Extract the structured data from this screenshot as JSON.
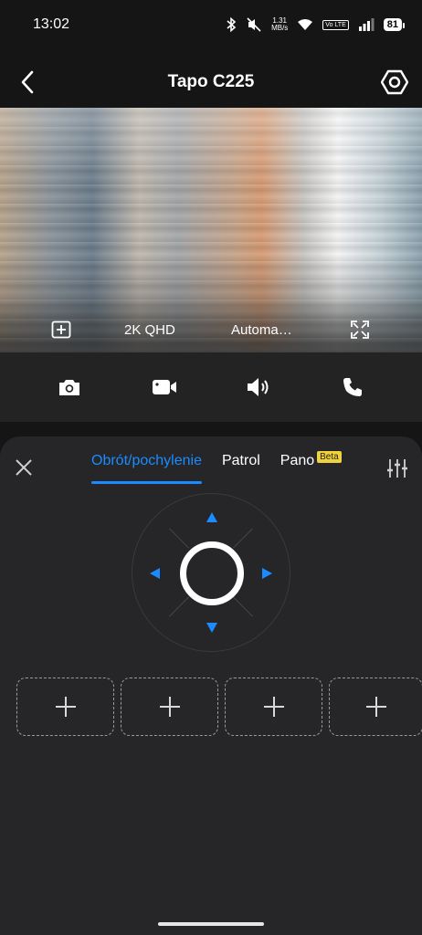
{
  "status_bar": {
    "time": "13:02",
    "speed_value": "1.31",
    "speed_unit": "MB/s",
    "volte": "Vo LTE",
    "battery": "81"
  },
  "header": {
    "title": "Tapo C225",
    "back_icon": "chevron-left-icon",
    "settings_icon": "hexagon-gear-icon"
  },
  "video_overlay": {
    "quality": "2K QHD",
    "mode": "Automa…",
    "add_icon": "plus-square-icon",
    "fullscreen_icon": "fullscreen-icon"
  },
  "controls": [
    {
      "name": "snapshot",
      "icon": "camera-icon"
    },
    {
      "name": "record",
      "icon": "video-camera-icon"
    },
    {
      "name": "speaker",
      "icon": "speaker-icon"
    },
    {
      "name": "call",
      "icon": "phone-icon"
    }
  ],
  "panel": {
    "tabs": [
      {
        "label": "Obrót/pochylenie",
        "active": true
      },
      {
        "label": "Patrol",
        "active": false
      },
      {
        "label": "Pano",
        "active": false,
        "badge": "Beta"
      }
    ],
    "close_icon": "close-icon",
    "tune_icon": "sliders-icon",
    "accent_color": "#1a8cff",
    "presets": [
      "+",
      "+",
      "+",
      "+"
    ]
  }
}
